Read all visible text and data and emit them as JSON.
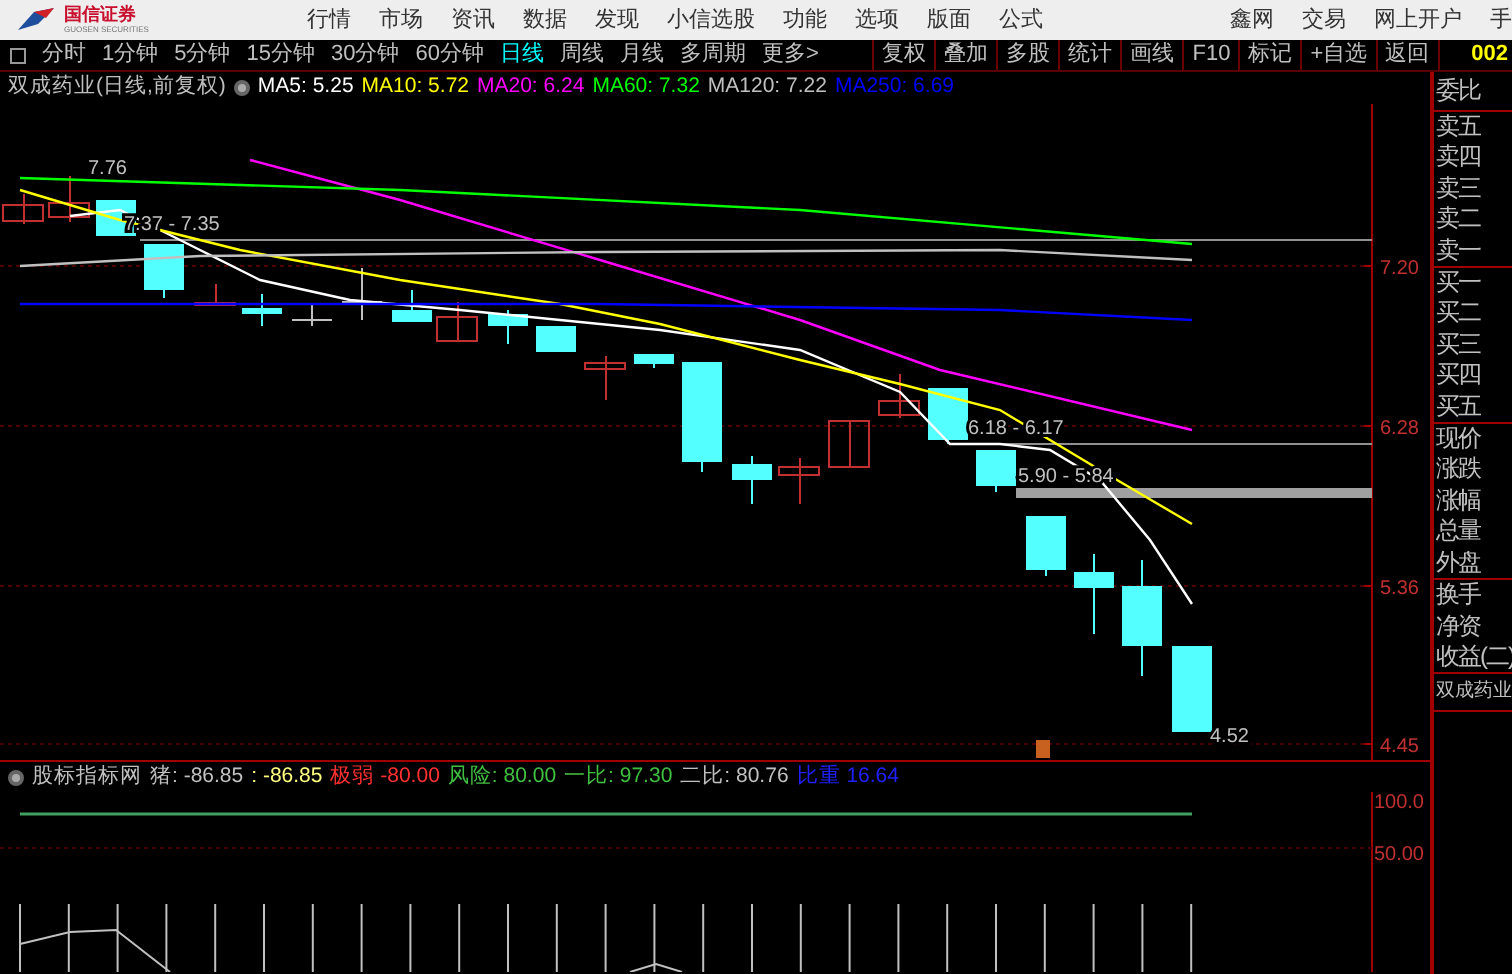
{
  "header": {
    "logo_text": "国信证券",
    "logo_subtext": "GUOSEN SECURITIES",
    "menu": [
      "行情",
      "市场",
      "资讯",
      "数据",
      "发现",
      "小信选股",
      "功能",
      "选项",
      "版面",
      "公式"
    ],
    "links": [
      "鑫网",
      "交易",
      "网上开户",
      "手"
    ]
  },
  "toolbar": {
    "periods": [
      {
        "label": "分时",
        "selected": false
      },
      {
        "label": "1分钟",
        "selected": false
      },
      {
        "label": "5分钟",
        "selected": false
      },
      {
        "label": "15分钟",
        "selected": false
      },
      {
        "label": "30分钟",
        "selected": false
      },
      {
        "label": "60分钟",
        "selected": false
      },
      {
        "label": "日线",
        "selected": true
      },
      {
        "label": "周线",
        "selected": false
      },
      {
        "label": "月线",
        "selected": false
      },
      {
        "label": "多周期",
        "selected": false
      },
      {
        "label": "更多>",
        "selected": false
      }
    ],
    "tools": [
      "复权",
      "叠加",
      "多股",
      "统计",
      "画线",
      "F10",
      "标记",
      "+自选",
      "返回"
    ],
    "stock_code": "002"
  },
  "chart": {
    "title": "双成药业(日线,前复权)",
    "indicators": [
      {
        "label": "MA5: 5.25",
        "color": "#ffffff"
      },
      {
        "label": "MA10: 5.72",
        "color": "#ffff00"
      },
      {
        "label": "MA20: 6.24",
        "color": "#ff00ff"
      },
      {
        "label": "MA60: 7.32",
        "color": "#00ff00"
      },
      {
        "label": "MA120: 7.22",
        "color": "#c0c0c0"
      },
      {
        "label": "MA250: 6.69",
        "color": "#0000ff"
      }
    ],
    "annotations": [
      "7.76",
      "7.37 - 7.35",
      "6.18 - 6.17",
      "5.90 - 5.84",
      "4.52"
    ],
    "yaxis": [
      "7.20",
      "6.28",
      "5.36",
      "4.45"
    ]
  },
  "indicator": {
    "name": "股标指标网",
    "values": [
      {
        "label": "猪: -86.85",
        "color": "#c0c0c0"
      },
      {
        "label": ": -86.85",
        "color": "#ffff80"
      },
      {
        "label": "极弱 -80.00",
        "color": "#ff3030"
      },
      {
        "label": "风险: 80.00",
        "color": "#40c040"
      },
      {
        "label": "一比: 97.30",
        "color": "#40c040"
      },
      {
        "label": "二比: 80.76",
        "color": "#c0c0c0"
      },
      {
        "label": "比重 16.64",
        "color": "#2020ff"
      }
    ],
    "yaxis": [
      "100.0",
      "50.00"
    ]
  },
  "quote_panel": {
    "groups": [
      [
        "委比"
      ],
      [
        "卖五",
        "卖四",
        "卖三",
        "卖二",
        "卖一"
      ],
      [
        "买一",
        "买二",
        "买三",
        "买四",
        "买五"
      ],
      [
        "现价",
        "涨跌",
        "涨幅",
        "总量",
        "外盘"
      ],
      [
        "换手",
        "净资",
        "收益(二)"
      ],
      [
        "双成药业"
      ]
    ]
  }
}
